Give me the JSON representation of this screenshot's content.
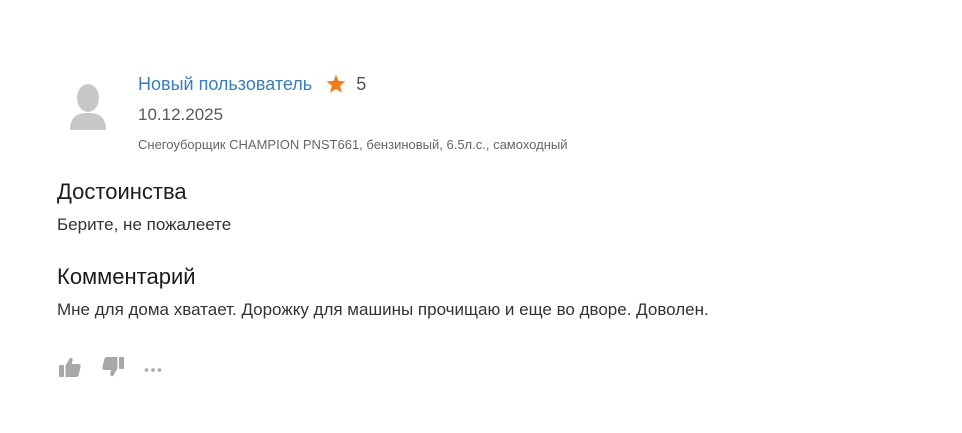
{
  "review": {
    "author": "Новый пользователь",
    "rating": "5",
    "date": "10.12.2025",
    "product": "Снегоуборщик CHAMPION PNST661, бензиновый, 6.5л.с., самоходный",
    "pros_title": "Достоинства",
    "pros_text": "Берите, не пожалеете",
    "comment_title": "Комментарий",
    "comment_text": "Мне для дома хватает. Дорожку для машины прочищаю и еще во дворе. Доволен."
  },
  "icons": {
    "avatar": "user-avatar-icon",
    "star": "star-icon",
    "like": "thumbs-up-icon",
    "dislike": "thumbs-down-icon",
    "more": "more-dots-icon"
  },
  "colors": {
    "author_link": "#3a7db8",
    "star": "#f07d1b",
    "icon_gray": "#a8a8a8",
    "avatar_gray": "#c8c8c8"
  }
}
